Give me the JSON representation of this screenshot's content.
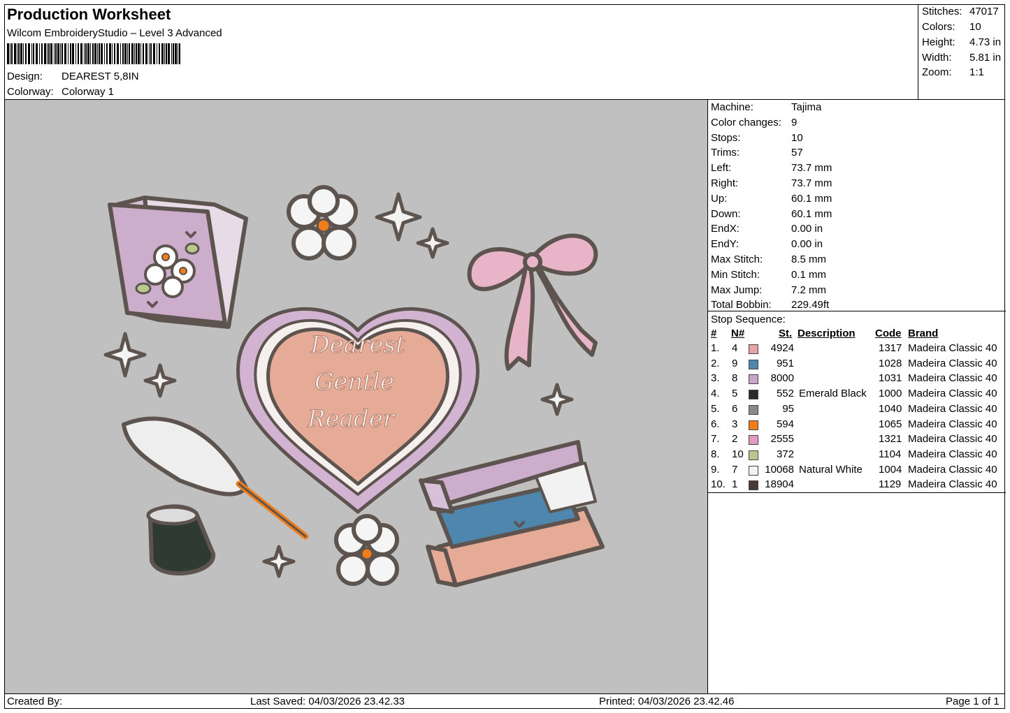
{
  "header": {
    "title": "Production Worksheet",
    "subtitle": "Wilcom EmbroideryStudio – Level 3 Advanced",
    "design_label": "Design:",
    "design_value": "DEAREST 5,8IN",
    "colorway_label": "Colorway:",
    "colorway_value": "Colorway 1"
  },
  "summary": [
    {
      "label": "Stitches:",
      "value": "47017"
    },
    {
      "label": "Colors:",
      "value": "10"
    },
    {
      "label": "Height:",
      "value": "4.73 in"
    },
    {
      "label": "Width:",
      "value": "5.81 in"
    },
    {
      "label": "Zoom:",
      "value": "1:1"
    }
  ],
  "machine_info": [
    {
      "label": "Machine:",
      "value": "Tajima"
    },
    {
      "label": "Color changes:",
      "value": "9"
    },
    {
      "label": "Stops:",
      "value": "10"
    },
    {
      "label": "Trims:",
      "value": "57"
    },
    {
      "label": "Left:",
      "value": "73.7 mm"
    },
    {
      "label": "Right:",
      "value": "73.7 mm"
    },
    {
      "label": "Up:",
      "value": "60.1 mm"
    },
    {
      "label": "Down:",
      "value": "60.1 mm"
    },
    {
      "label": "EndX:",
      "value": "0.00 in"
    },
    {
      "label": "EndY:",
      "value": "0.00 in"
    },
    {
      "label": "Max Stitch:",
      "value": "8.5 mm"
    },
    {
      "label": "Min Stitch:",
      "value": "0.1 mm"
    },
    {
      "label": "Max Jump:",
      "value": "7.2 mm"
    },
    {
      "label": "Total Bobbin:",
      "value": "229.49ft"
    }
  ],
  "stop_sequence": {
    "title": "Stop Sequence:",
    "headers": {
      "num": "#",
      "n": "N#",
      "st": "St.",
      "desc": "Description",
      "code": "Code",
      "brand": "Brand"
    },
    "rows": [
      {
        "num": "1.",
        "n": "4",
        "color": "#e8a3a3",
        "st": "4924",
        "desc": "",
        "code": "1317",
        "brand": "Madeira Classic 40"
      },
      {
        "num": "2.",
        "n": "9",
        "color": "#4f86ad",
        "st": "951",
        "desc": "",
        "code": "1028",
        "brand": "Madeira Classic 40"
      },
      {
        "num": "3.",
        "n": "8",
        "color": "#c9a6c9",
        "st": "8000",
        "desc": "",
        "code": "1031",
        "brand": "Madeira Classic 40"
      },
      {
        "num": "4.",
        "n": "5",
        "color": "#2a2a2a",
        "st": "552",
        "desc": "Emerald Black",
        "code": "1000",
        "brand": "Madeira Classic 40"
      },
      {
        "num": "5.",
        "n": "6",
        "color": "#8a8a8a",
        "st": "95",
        "desc": "",
        "code": "1040",
        "brand": "Madeira Classic 40"
      },
      {
        "num": "6.",
        "n": "3",
        "color": "#f07d1a",
        "st": "594",
        "desc": "",
        "code": "1065",
        "brand": "Madeira Classic 40"
      },
      {
        "num": "7.",
        "n": "2",
        "color": "#e39ac0",
        "st": "2555",
        "desc": "",
        "code": "1321",
        "brand": "Madeira Classic 40"
      },
      {
        "num": "8.",
        "n": "10",
        "color": "#b9c98e",
        "st": "372",
        "desc": "",
        "code": "1104",
        "brand": "Madeira Classic 40"
      },
      {
        "num": "9.",
        "n": "7",
        "color": "#f2f2f2",
        "st": "10068",
        "desc": "Natural White",
        "code": "1004",
        "brand": "Madeira Classic 40"
      },
      {
        "num": "10.",
        "n": "1",
        "color": "#4a3a34",
        "st": "18904",
        "desc": "",
        "code": "1129",
        "brand": "Madeira Classic 40"
      }
    ]
  },
  "design_text": {
    "line1": "Dearest",
    "line2": "Gentle",
    "line3": "Reader"
  },
  "footer": {
    "created_by": "Created By:",
    "last_saved": "Last Saved: 04/03/2026 23.42.33",
    "printed": "Printed: 04/03/2026 23.42.46",
    "page": "Page 1 of 1"
  }
}
